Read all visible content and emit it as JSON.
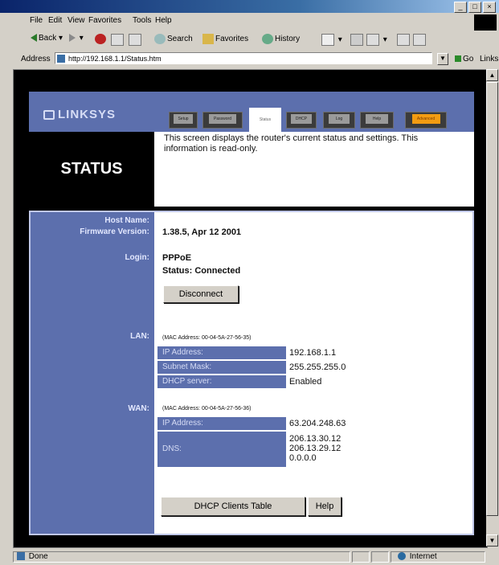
{
  "browser": {
    "menu": [
      "File",
      "Edit",
      "View",
      "Favorites",
      "Tools",
      "Help"
    ],
    "toolbar": {
      "back": "Back",
      "search": "Search",
      "favorites": "Favorites",
      "history": "History"
    },
    "address": {
      "label": "Address",
      "url": "http://192.168.1.1/Status.htm",
      "go": "Go",
      "links": "Links"
    },
    "statusbar": {
      "left": "Done",
      "zone": "Internet"
    }
  },
  "page": {
    "brand": "LINKSYS",
    "tabs": [
      "Setup",
      "Password",
      "Status",
      "DHCP",
      "Log",
      "Help",
      "Advanced"
    ],
    "active_tab": "Status",
    "title": "STATUS",
    "description": "This screen displays the router's current status and settings. This information is read-only.",
    "host_name_label": "Host Name:",
    "firmware_label": "Firmware Version:",
    "firmware_value": "1.38.5, Apr 12 2001",
    "login_label": "Login:",
    "login_type": "PPPoE",
    "login_status": "Status: Connected",
    "disconnect_button": "Disconnect",
    "lan": {
      "label": "LAN:",
      "mac": "(MAC Address: 00-04-5A-27-56-35)",
      "rows": [
        {
          "key": "IP Address:",
          "value": "192.168.1.1"
        },
        {
          "key": "Subnet Mask:",
          "value": "255.255.255.0"
        },
        {
          "key": "DHCP server:",
          "value": "Enabled"
        }
      ]
    },
    "wan": {
      "label": "WAN:",
      "mac": "(MAC Address: 00-04-5A-27-56-36)",
      "ip_key": "IP Address:",
      "ip_value": "63.204.248.63",
      "dns_key": "DNS:",
      "dns_values": [
        "206.13.30.12",
        "206.13.29.12",
        "0.0.0.0"
      ]
    },
    "dhcp_clients_button": "DHCP Clients Table",
    "help_button": "Help"
  }
}
